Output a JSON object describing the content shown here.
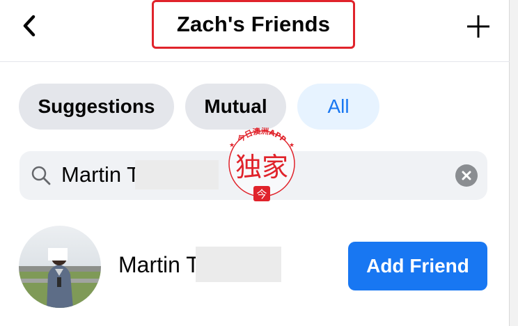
{
  "header": {
    "title": "Zach's Friends",
    "back_icon": "chevron-left-icon",
    "add_icon": "plus-icon",
    "highlight_color": "#e0232b"
  },
  "filters": [
    {
      "label": "Suggestions",
      "active": false
    },
    {
      "label": "Mutual",
      "active": false
    },
    {
      "label": "All",
      "active": true
    }
  ],
  "search": {
    "value": "Martin T",
    "search_icon": "search-icon",
    "clear_icon": "clear-icon"
  },
  "watermark": {
    "arc_text": "今日澳洲APP",
    "main_text": "独家",
    "badge_text": "今",
    "color": "#e0232b"
  },
  "results": [
    {
      "name": "Martin T",
      "action_label": "Add Friend",
      "avatar_icon": "profile-photo"
    }
  ],
  "colors": {
    "accent": "#1877f2",
    "chip_gray": "#e4e6eb",
    "chip_active_bg": "#e7f3ff",
    "search_bg": "#f0f2f5"
  }
}
